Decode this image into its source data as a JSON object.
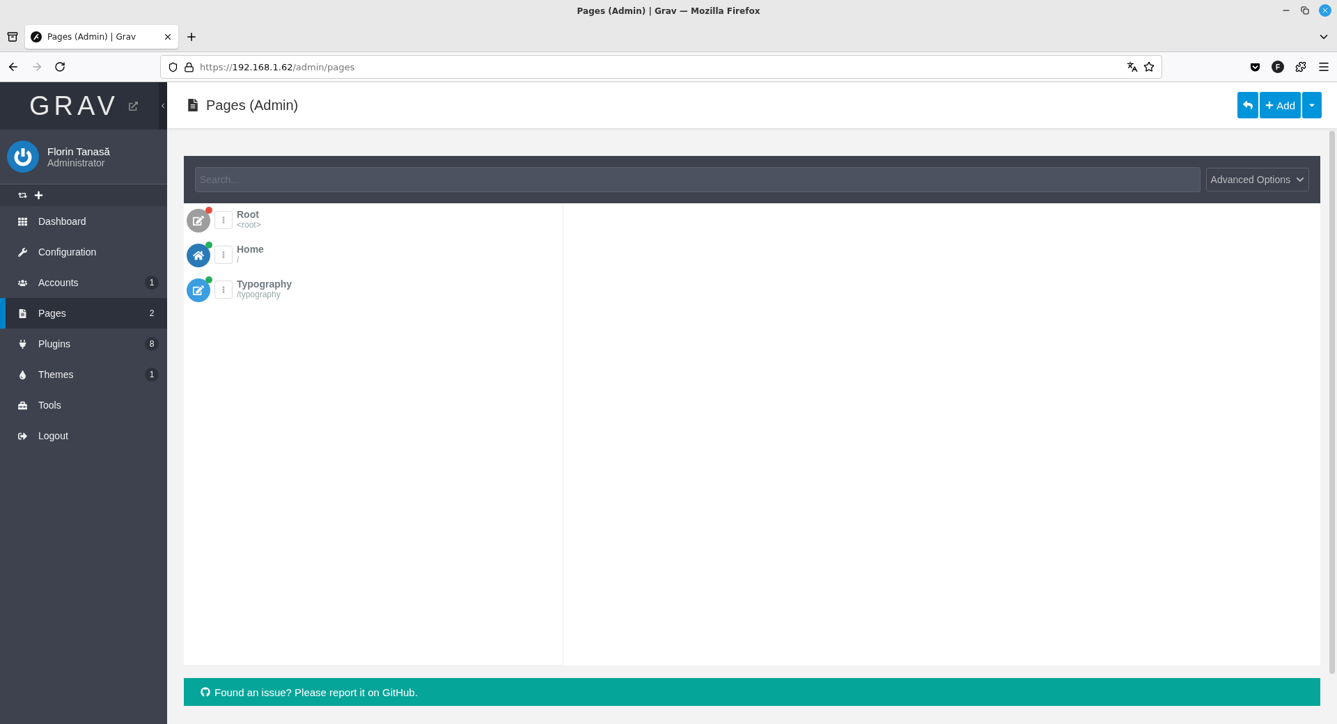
{
  "window": {
    "title": "Pages (Admin) | Grav — Mozilla Firefox"
  },
  "browser": {
    "tabs": [
      {
        "label": "Pages (Admin) | Grav",
        "selected": true
      }
    ],
    "url_host": "https://",
    "url_main": "192.168.1.62",
    "url_path": "/admin/pages",
    "account_initial": "F"
  },
  "sidebar": {
    "logo": "GRAV",
    "user": {
      "name": "Florin Tanasă",
      "role": "Administrator"
    },
    "items": [
      {
        "label": "Dashboard",
        "selected": false
      },
      {
        "label": "Configuration",
        "selected": false
      },
      {
        "label": "Accounts",
        "selected": false,
        "badge": "1"
      },
      {
        "label": "Pages",
        "selected": true,
        "badge": "2"
      },
      {
        "label": "Plugins",
        "selected": false,
        "badge": "8"
      },
      {
        "label": "Themes",
        "selected": false,
        "badge": "1"
      },
      {
        "label": "Tools",
        "selected": false
      },
      {
        "label": "Logout",
        "selected": false
      }
    ]
  },
  "header": {
    "title": "Pages (Admin)",
    "add_button": "Add"
  },
  "search": {
    "placeholder": "Search...",
    "advanced": "Advanced Options"
  },
  "pages": [
    {
      "kind": "root",
      "title": "Root",
      "route": "<root>",
      "color": "#e74c3c"
    },
    {
      "kind": "home",
      "title": "Home",
      "route": "/",
      "color": "#27ae60"
    },
    {
      "kind": "page",
      "title": "Typography",
      "route": "/typography",
      "color": "#27ae60"
    }
  ],
  "footer": {
    "text": "Found an issue? Please report it on GitHub."
  }
}
